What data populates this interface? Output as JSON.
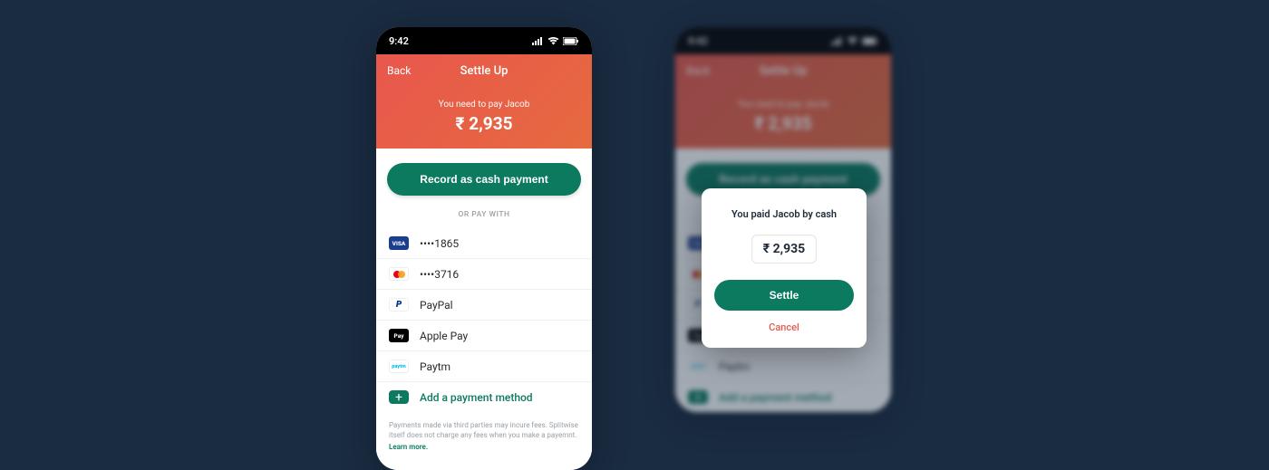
{
  "status": {
    "time": "9:42"
  },
  "header": {
    "back": "Back",
    "title": "Settle Up",
    "pay_line": "You need to pay Jacob",
    "amount": "₹ 2,935"
  },
  "primary_btn": "Record as cash payment",
  "divider": "OR PAY WITH",
  "payment_methods": [
    {
      "icon": "visa",
      "icon_text": "VISA",
      "label": "••••1865"
    },
    {
      "icon": "mc",
      "icon_text": "",
      "label": "••••3716"
    },
    {
      "icon": "paypal",
      "icon_text": "P",
      "label": "PayPal"
    },
    {
      "icon": "applepay",
      "icon_text": "Pay",
      "label": "Apple Pay"
    },
    {
      "icon": "paytm",
      "icon_text": "paytm",
      "label": "Paytm"
    }
  ],
  "add_method": "Add a payment method",
  "footnote": {
    "text": "Payments made via third parties may incure fees. Splitwise itself does not charge any fees when you make a payemnt.",
    "learn": "Learn more."
  },
  "modal": {
    "title": "You paid Jacob by cash",
    "amount": "₹ 2,935",
    "settle": "Settle",
    "cancel": "Cancel"
  }
}
